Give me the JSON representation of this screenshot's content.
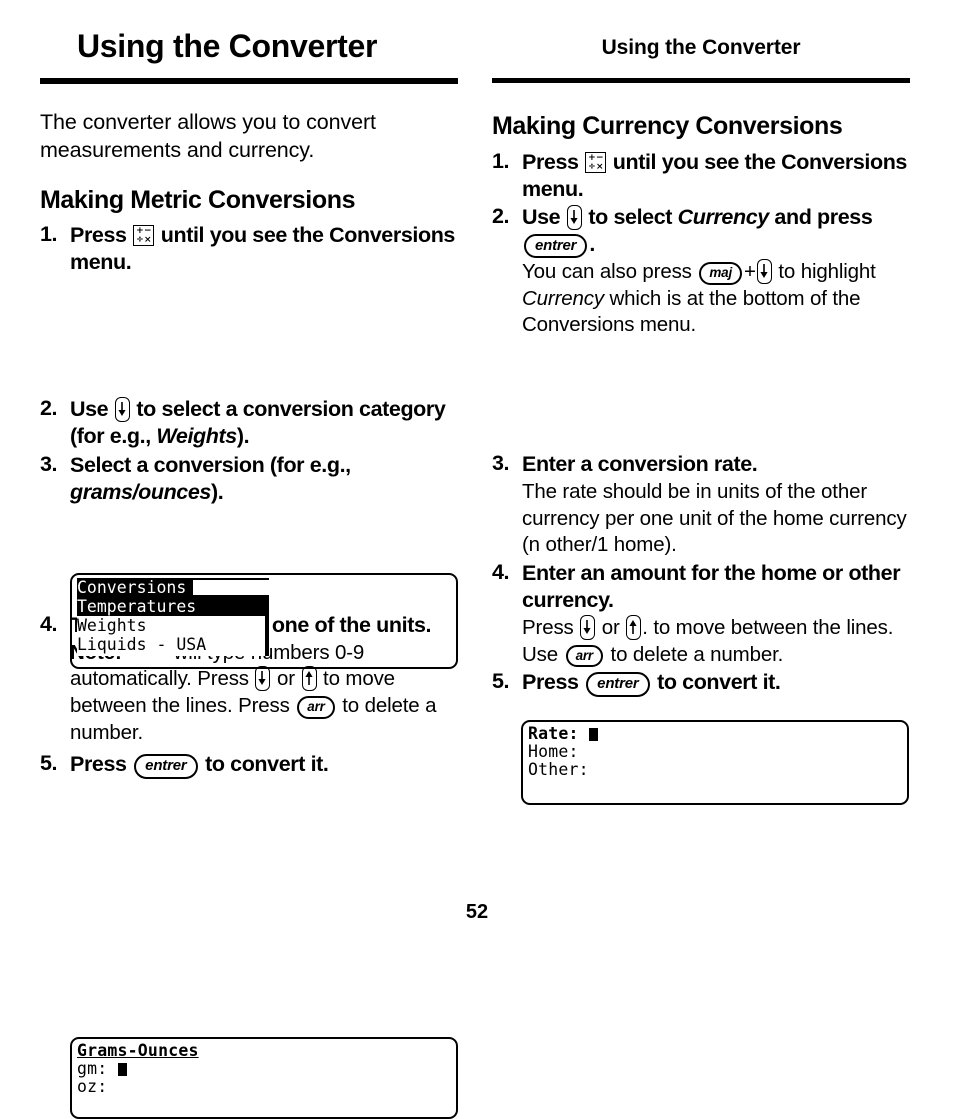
{
  "page": {
    "folio": "52"
  },
  "left_column": {
    "running_head": "Using the Converter",
    "intro": "The converter allows you to convert measurements and currency.",
    "section_title": "Making Metric Conversions",
    "steps": [
      {
        "num": "1.",
        "main_before": "Press",
        "key": "calculator-key",
        "main_after": "until you see the Conversions menu."
      },
      {
        "num": "2.",
        "main_before": "Use",
        "key": "down-arrow-key",
        "main_after": "to select a conversion category (for e.g.,",
        "italic": "Weights",
        "main_tail": ")."
      },
      {
        "num": "3.",
        "main_before": "Select a conversion (for e.g.,",
        "italic": "grams/ounces",
        "main_tail": ")."
      },
      {
        "num": "4.",
        "main": "Type a number after one of the units.",
        "note_label": "Note:",
        "note_1": "will type numbers 0-9 automatically. Press",
        "note_2": "or",
        "note_3": "to move between the lines. Press",
        "note_4": "to delete a number.",
        "key_arr": "arr"
      },
      {
        "num": "5.",
        "main_before": "Press",
        "key_entrer": "entrer",
        "main_after": "to convert it."
      }
    ],
    "lcd_conversions": {
      "title": "Conversions",
      "rows": [
        "Temperatures",
        "Weights",
        "Liquids - USA"
      ],
      "highlighted_row": "Temperatures"
    },
    "lcd_grams": {
      "title": "Grams-Ounces",
      "rows": [
        "gm:",
        "oz:"
      ],
      "cursor_on": "gm:"
    }
  },
  "right_column": {
    "running_head": "Using the Converter",
    "section_title": "Making Currency Conversions",
    "steps": [
      {
        "num": "1.",
        "main_before": "Press",
        "key": "calculator-key",
        "main_after": "until you see the Conversions menu."
      },
      {
        "num": "2.",
        "main_before": "Use",
        "key": "down-arrow-key",
        "main_mid": "to select",
        "italic": "Currency",
        "main_after": "and press",
        "key_entrer": "entrer",
        "main_tail": ".",
        "note_1": "You can also press",
        "key_maj": "maj",
        "note_plus": "+",
        "note_2": "to highlight",
        "note_italic": "Currency",
        "note_3": "which is at the bottom of the Conversions menu."
      },
      {
        "num": "3.",
        "main": "Enter a conversion rate.",
        "note": "The rate should be in units of the other currency per one unit of the home currency (n other/1 home)."
      },
      {
        "num": "4.",
        "main": "Enter an amount for the home or other currency.",
        "note_1": "Press",
        "note_2": "or",
        "note_3": ". to move between the lines. Use",
        "note_4": "to delete a number.",
        "key_arr": "arr"
      },
      {
        "num": "5.",
        "main_before": "Press",
        "key_entrer": "entrer",
        "main_after": "to convert it."
      }
    ],
    "lcd_rate": {
      "rows": [
        "Rate:",
        "Home:",
        "Other:"
      ],
      "cursor_on": "Rate:"
    }
  },
  "keys": {
    "calculator": {
      "plus": "+",
      "minus": "−",
      "divide": "÷",
      "times": "×"
    },
    "entrer_label": "entrer",
    "arr_label": "arr",
    "maj_label": "maj"
  },
  "colors": {
    "ink": "#000000",
    "paper": "#ffffff",
    "lcd_bg": "#ffffff",
    "lcd_highlight": "#000000"
  }
}
